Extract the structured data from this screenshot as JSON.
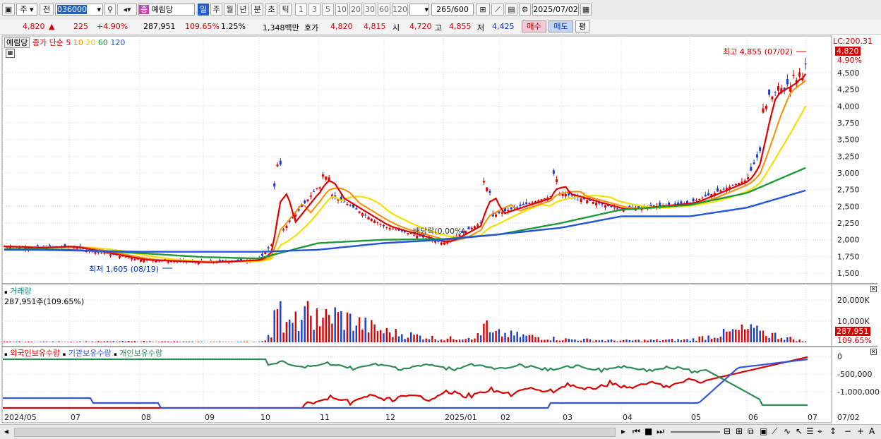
{
  "toolbar": {
    "mode": "주",
    "prev": "전",
    "code": "036000",
    "name": "예림당",
    "periods": [
      "일",
      "주",
      "월",
      "년",
      "분",
      "초",
      "틱"
    ],
    "active_period": "일",
    "ticks": [
      "1",
      "3",
      "5",
      "10",
      "20",
      "30",
      "60",
      "120"
    ],
    "count": "265",
    "count_max": "/600",
    "date": "2025/07/02"
  },
  "quote": {
    "price": "4,820",
    "arrow": "▲",
    "change": "225",
    "change_pct": "+4.90%",
    "volume": "287,951",
    "vol_ratio": "109.65%",
    "turnover": "1.25%",
    "amount": "1,348백만",
    "ask_label": "호가",
    "ask": "4,820",
    "bid": "4,815",
    "open_label": "시",
    "open": "4,720",
    "high_label": "고",
    "high": "4,855",
    "low_label": "저",
    "low": "4,425",
    "buy_button": "매수",
    "sell_button": "매도",
    "avg_button": "평"
  },
  "price_panel": {
    "stock": "예림당",
    "ma_title": "종가 단순",
    "ma_periods": [
      "5",
      "10",
      "20",
      "60",
      "120"
    ],
    "ma_colors": [
      "#e00000",
      "#ff8c00",
      "#f5e000",
      "#1f9a3a",
      "#2255dd"
    ],
    "lc_label": "LC:200.31",
    "last_price": "4,820",
    "last_pct": "4.90%",
    "y_ticks": [
      "4,500",
      "4,250",
      "4,000",
      "3,750",
      "3,500",
      "3,250",
      "3,000",
      "2,750",
      "2,500",
      "2,250",
      "2,000",
      "1,750",
      "1,500"
    ],
    "max_note": "최고 4,855 (07/02)",
    "min_note": "최저 1,605 (08/19)",
    "div_note": "배당락(0.00%)"
  },
  "volume_panel": {
    "title": "거래량",
    "value": "287,951주(109.65%)",
    "y_ticks": [
      "20,000K",
      "10,000K"
    ],
    "last_value": "287,951",
    "last_pct": "109.65%"
  },
  "holding_panel": {
    "series": [
      "외국인보유수량",
      "기관보유수량",
      "개인보유수량"
    ],
    "colors": [
      "#dd0000",
      "#3355dd",
      "#2e8b57"
    ],
    "y_ticks": [
      "0",
      "-500,000",
      "-1,000,000"
    ]
  },
  "x_axis": {
    "labels": [
      "2024/05",
      "07",
      "08",
      "09",
      "10",
      "11",
      "12",
      "2025/01",
      "02",
      "03",
      "04",
      "05",
      "06",
      "07"
    ],
    "last_date": "07/02"
  },
  "chart_data": {
    "type": "line",
    "title": "예림당 (036000) 일봉",
    "x": [
      "2024/05",
      "2024/06",
      "2024/07",
      "2024/08",
      "2024/09",
      "2024/10",
      "2024/11",
      "2024/12",
      "2025/01",
      "2025/02",
      "2025/03",
      "2025/04",
      "2025/05",
      "2025/06",
      "2025/07"
    ],
    "series": [
      {
        "name": "종가",
        "values": [
          1900,
          1880,
          1900,
          1700,
          1660,
          1700,
          2800,
          2200,
          1950,
          2400,
          2700,
          2450,
          2550,
          2900,
          4820
        ]
      },
      {
        "name": "MA60",
        "values": [
          1860,
          1860,
          1850,
          1800,
          1740,
          1720,
          1950,
          2000,
          2010,
          2080,
          2250,
          2450,
          2520,
          2700,
          3080
        ]
      },
      {
        "name": "MA120",
        "values": [
          1850,
          1850,
          1840,
          1820,
          1820,
          1820,
          1850,
          1950,
          2000,
          2080,
          2180,
          2350,
          2350,
          2480,
          2740
        ]
      },
      {
        "name": "거래량(K)",
        "values": [
          300,
          250,
          300,
          450,
          200,
          200,
          15000,
          5000,
          1500,
          4000,
          1500,
          800,
          1200,
          6000,
          288
        ]
      }
    ],
    "ylim": [
      1500,
      4855
    ],
    "high": {
      "value": 4855,
      "date": "07/02"
    },
    "low": {
      "value": 1605,
      "date": "08/19"
    }
  }
}
